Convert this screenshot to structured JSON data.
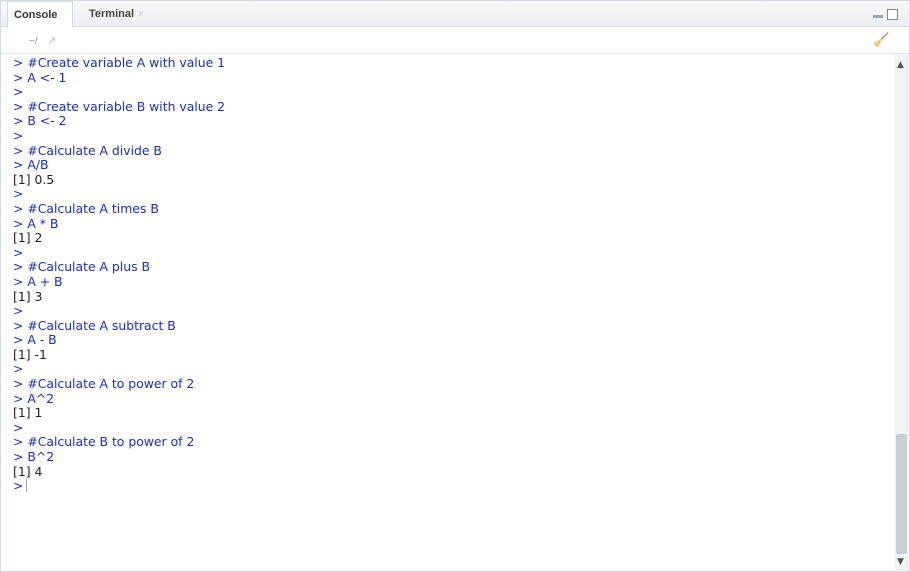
{
  "tabs": [
    {
      "label": "Console"
    },
    {
      "label": "Terminal",
      "close": "×"
    }
  ],
  "path": {
    "text": "~/",
    "go_icon": "↗"
  },
  "console_lines": [
    {
      "kind": "in",
      "text": "> #Create variable A with value 1"
    },
    {
      "kind": "in",
      "text": "> A <- 1"
    },
    {
      "kind": "in",
      "text": ">"
    },
    {
      "kind": "in",
      "text": "> #Create variable B with value 2"
    },
    {
      "kind": "in",
      "text": "> B <- 2"
    },
    {
      "kind": "in",
      "text": ">"
    },
    {
      "kind": "in",
      "text": "> #Calculate A divide B"
    },
    {
      "kind": "in",
      "text": "> A/B"
    },
    {
      "kind": "out",
      "text": "[1] 0.5"
    },
    {
      "kind": "in",
      "text": ">"
    },
    {
      "kind": "in",
      "text": "> #Calculate A times B"
    },
    {
      "kind": "in",
      "text": "> A * B"
    },
    {
      "kind": "out",
      "text": "[1] 2"
    },
    {
      "kind": "in",
      "text": ">"
    },
    {
      "kind": "in",
      "text": "> #Calculate A plus B"
    },
    {
      "kind": "in",
      "text": "> A + B"
    },
    {
      "kind": "out",
      "text": "[1] 3"
    },
    {
      "kind": "in",
      "text": ">"
    },
    {
      "kind": "in",
      "text": "> #Calculate A subtract B"
    },
    {
      "kind": "in",
      "text": "> A - B"
    },
    {
      "kind": "out",
      "text": "[1] -1"
    },
    {
      "kind": "in",
      "text": ">"
    },
    {
      "kind": "in",
      "text": "> #Calculate A to power of 2"
    },
    {
      "kind": "in",
      "text": "> A^2"
    },
    {
      "kind": "out",
      "text": "[1] 1"
    },
    {
      "kind": "in",
      "text": ">"
    },
    {
      "kind": "in",
      "text": "> #Calculate B to power of 2"
    },
    {
      "kind": "in",
      "text": "> B^2"
    },
    {
      "kind": "out",
      "text": "[1] 4"
    }
  ],
  "prompt": ">",
  "colors": {
    "input": "#1a2fbf",
    "output": "#222222"
  }
}
